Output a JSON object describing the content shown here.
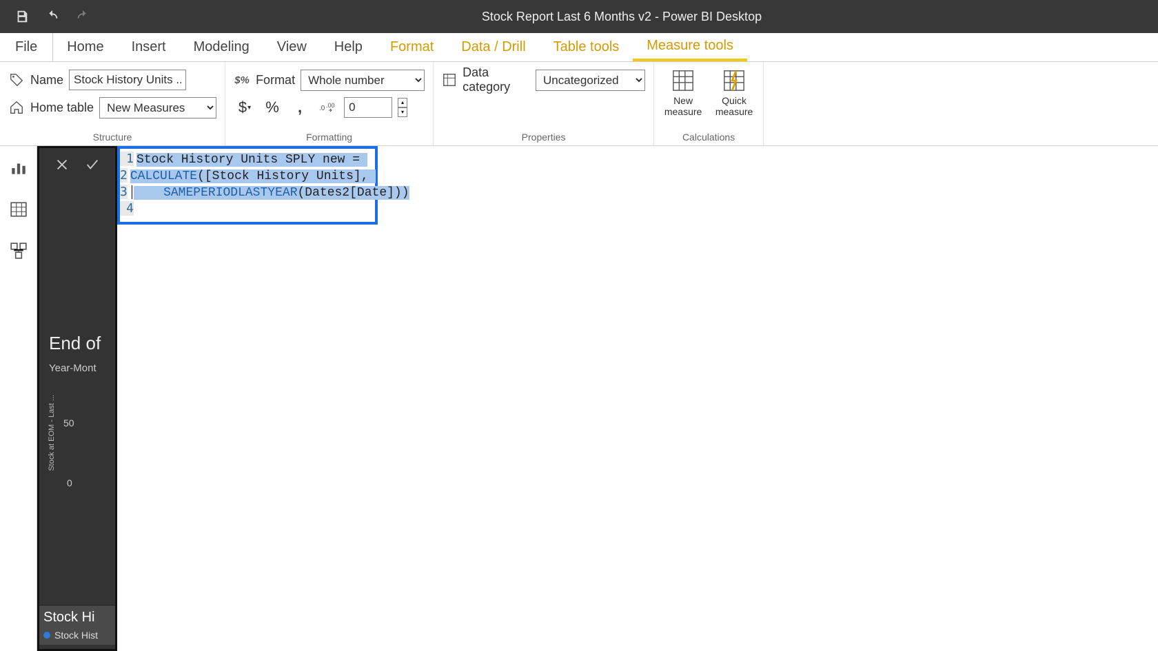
{
  "titlebar": {
    "title": "Stock Report Last 6 Months v2 - Power BI Desktop"
  },
  "tabs": {
    "file": "File",
    "home": "Home",
    "insert": "Insert",
    "modeling": "Modeling",
    "view": "View",
    "help": "Help",
    "format": "Format",
    "data_drill": "Data / Drill",
    "table_tools": "Table tools",
    "measure_tools": "Measure tools"
  },
  "structure": {
    "name_label": "Name",
    "name_value": "Stock History Units ...",
    "home_label": "Home table",
    "home_value": "New Measures",
    "group": "Structure"
  },
  "formatting": {
    "format_label": "Format",
    "format_value": "Whole number",
    "decimals": "0",
    "group": "Formatting"
  },
  "properties": {
    "cat_label": "Data category",
    "cat_value": "Uncategorized",
    "group": "Properties"
  },
  "calculations": {
    "new_measure": "New\nmeasure",
    "quick_measure": "Quick\nmeasure",
    "group": "Calculations"
  },
  "formula": {
    "line1_a": "Stock History Units SPLY new = ",
    "line2_fn": "CALCULATE",
    "line2_rest": "([Stock History Units], ",
    "line3_indent": "    ",
    "line3_fn": "SAMEPERIODLASTYEAR",
    "line3_rest": "(Dates2[Date]))",
    "ln1": "1",
    "ln2": "2",
    "ln3": "3",
    "ln4": "4"
  },
  "side": {
    "chart_title": "End of",
    "chart_sub": "Year-Mont",
    "axis_label": "Stock at EOM - Last ...",
    "tick50": "50",
    "tick0": "0",
    "v2_title": "Stock Hi",
    "v2_legend": "Stock Hist"
  }
}
